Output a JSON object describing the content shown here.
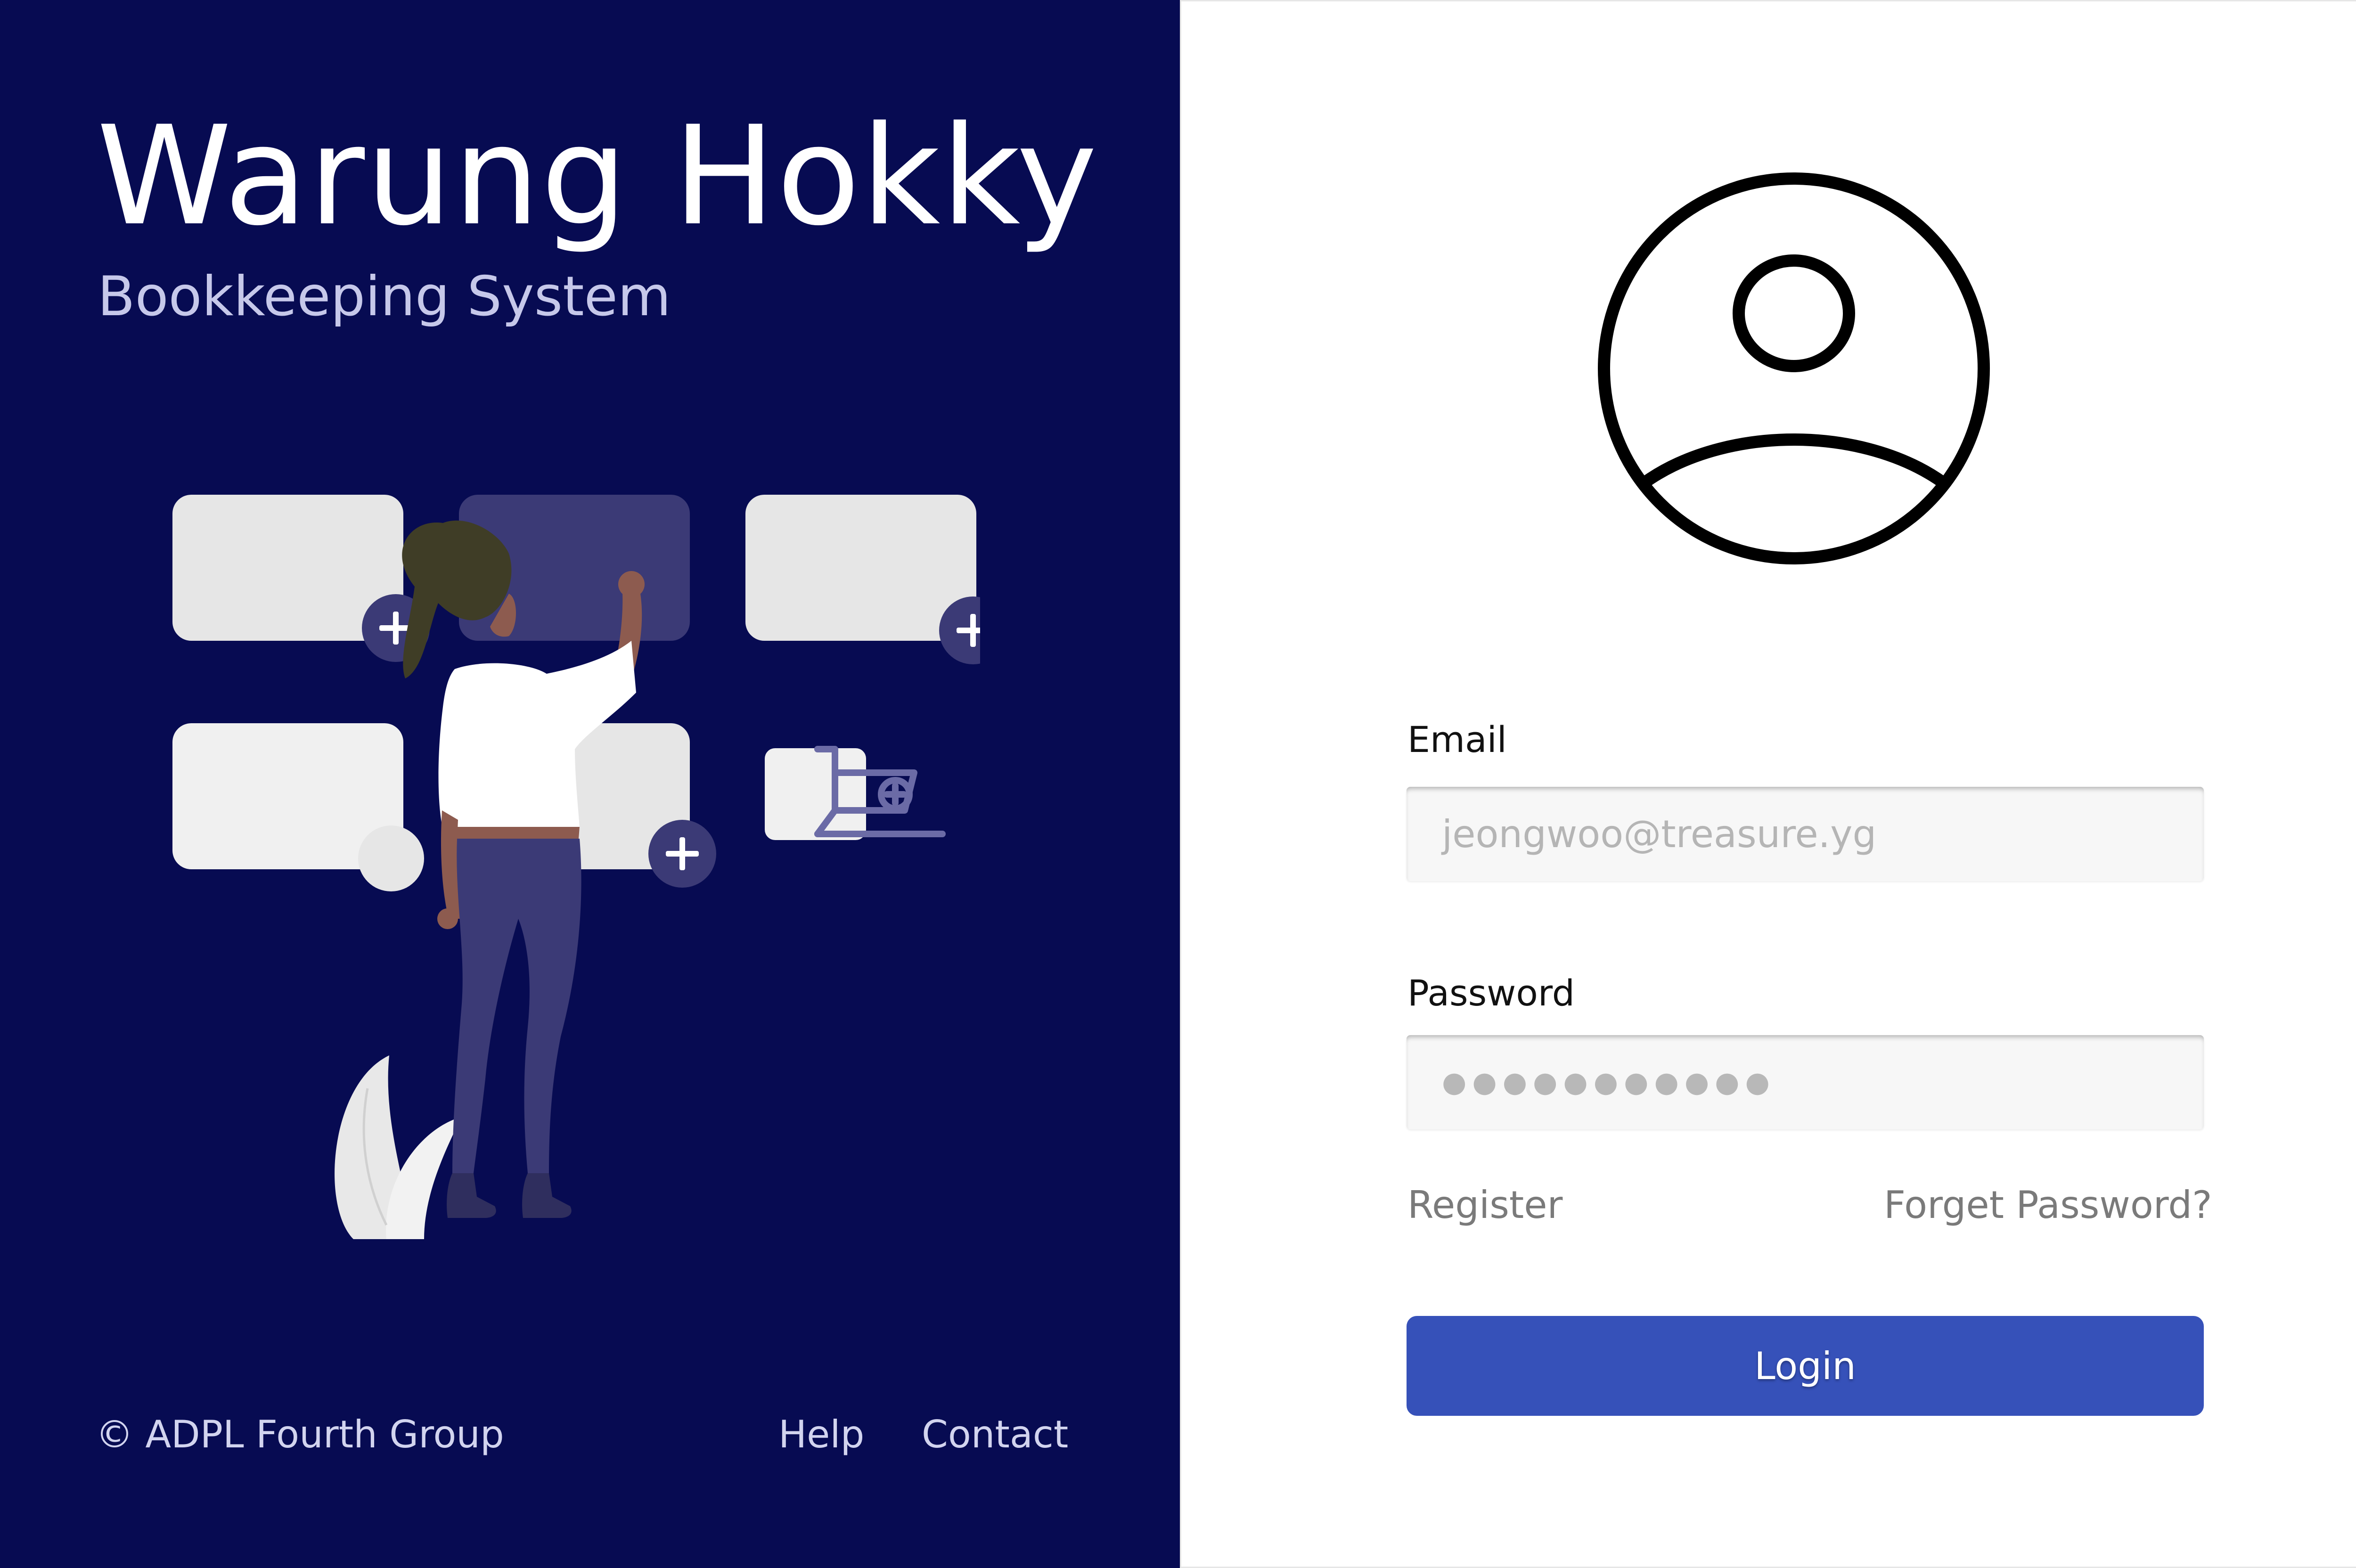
{
  "brand": {
    "title": "Warung Hokky",
    "subtitle": "Bookkeeping System"
  },
  "footer": {
    "copyright": "© ADPL Fourth Group",
    "help": "Help",
    "contact": "Contact"
  },
  "form": {
    "email_label": "Email",
    "email_value": "jeongwoo@treasure.yg",
    "password_label": "Password",
    "password_mask": "●●●●●●●●●●●",
    "register_link": "Register",
    "forget_link": "Forget Password?",
    "login_button": "Login"
  },
  "icons": {
    "avatar": "user-circle-icon",
    "plus": "plus-icon",
    "cart": "shopping-cart-icon"
  },
  "colors": {
    "left_panel_bg": "#070b52",
    "primary_button": "#3651b9",
    "card_light": "#e6e6e6",
    "card_highlight": "#3b3a76",
    "plus_badge": "#3b3a76"
  }
}
